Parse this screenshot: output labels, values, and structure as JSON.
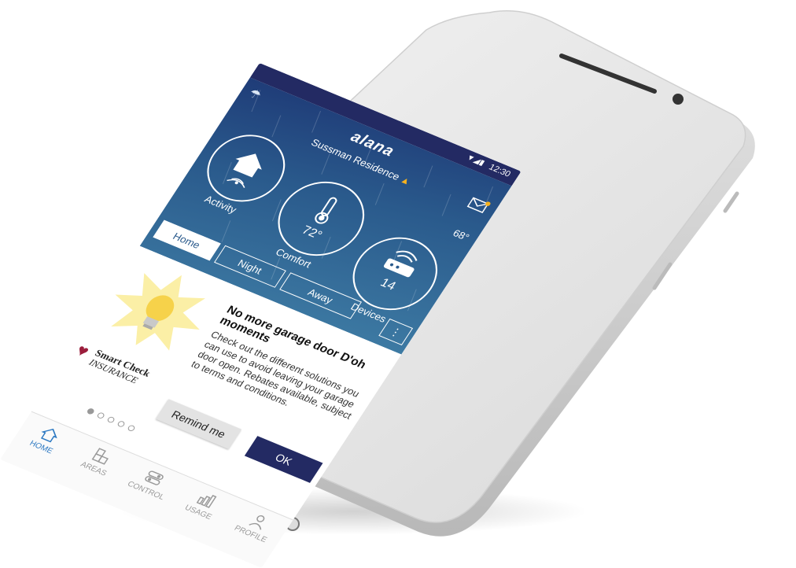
{
  "status": {
    "time": "12:30",
    "signal": "▼◢▮"
  },
  "header": {
    "brand": "alana",
    "residence": "Sussman Residence",
    "warning_glyph": "▲",
    "outdoor_temp": "68°",
    "weather_icon": "cloud-rain-icon",
    "mail_icon": "mail-icon"
  },
  "tiles": [
    {
      "label": "Activity",
      "value": "",
      "icon": "home-signal-icon"
    },
    {
      "label": "Comfort",
      "value": "72°",
      "icon": "thermometer-icon"
    },
    {
      "label": "Devices",
      "value": "14",
      "icon": "router-icon"
    }
  ],
  "modes": [
    {
      "label": "Home",
      "active": true
    },
    {
      "label": "Night",
      "active": false
    },
    {
      "label": "Away",
      "active": false
    }
  ],
  "more_label": "⋮",
  "promo": {
    "headline": "No more garage door D'oh moments",
    "body": "Check out the different solutions you can use to avoid leaving your garage door open. Rebates available, subject to terms and conditions.",
    "partner_line1": "Smart Check",
    "partner_line2": "INSURANCE",
    "remind_label": "Remind me",
    "ok_label": "OK",
    "dots_total": 5,
    "dots_active": 1
  },
  "nav": [
    {
      "label": "HOME",
      "icon": "home-icon",
      "active": true
    },
    {
      "label": "AREAS",
      "icon": "areas-icon",
      "active": false
    },
    {
      "label": "CONTROL",
      "icon": "control-icon",
      "active": false
    },
    {
      "label": "USAGE",
      "icon": "usage-icon",
      "active": false
    },
    {
      "label": "PROFILE",
      "icon": "profile-icon",
      "active": false
    }
  ],
  "colors": {
    "statusbar": "#232a63",
    "accent": "#2b78c2",
    "ok_button": "#232a63",
    "warning": "#f7b21e",
    "partner": "#9b1d3c"
  }
}
